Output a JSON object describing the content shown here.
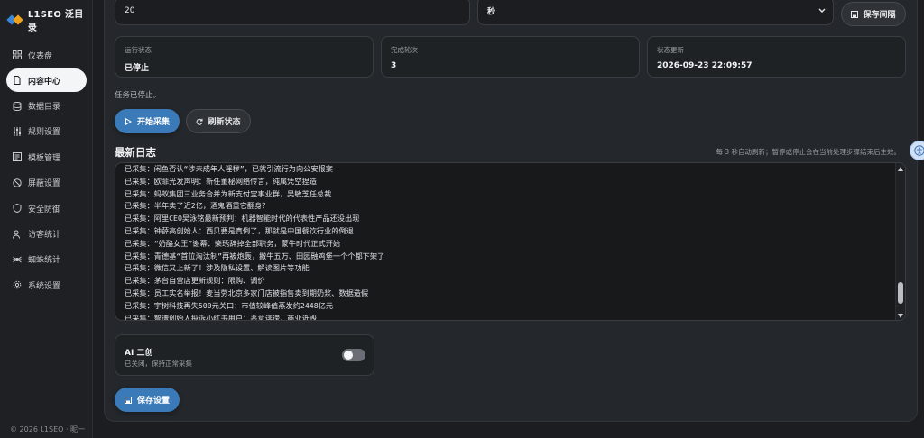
{
  "brand": {
    "name": "L1SEO 泛目录"
  },
  "nav": [
    {
      "label": "仪表盘",
      "icon": "grid-icon"
    },
    {
      "label": "内容中心",
      "icon": "file-icon",
      "active": true
    },
    {
      "label": "数据目录",
      "icon": "database-icon"
    },
    {
      "label": "规则设置",
      "icon": "sliders-icon"
    },
    {
      "label": "模板管理",
      "icon": "template-icon"
    },
    {
      "label": "屏蔽设置",
      "icon": "block-icon"
    },
    {
      "label": "安全防御",
      "icon": "shield-icon"
    },
    {
      "label": "访客统计",
      "icon": "users-icon"
    },
    {
      "label": "蜘蛛统计",
      "icon": "spider-icon"
    },
    {
      "label": "系统设置",
      "icon": "gear-icon"
    }
  ],
  "footer": "© 2026 L1SEO · 昵一",
  "interval": {
    "value": "20",
    "unit": "秒",
    "save_label": "保存间隔"
  },
  "stats": [
    {
      "label": "运行状态",
      "value": "已停止"
    },
    {
      "label": "完成轮次",
      "value": "3"
    },
    {
      "label": "状态更新",
      "value": "2026-09-23 22:09:57"
    }
  ],
  "status_message": "任务已停止。",
  "actions": {
    "start_label": "开始采集",
    "refresh_label": "刷新状态"
  },
  "log": {
    "title": "最新日志",
    "hint": "每 3 秒自动刷新；暂停或停止会在当前处理步骤结束后生效。",
    "lines": [
      "已采集：闲鱼否认“涉未成年人淫秽”，已就引流行为向公安报案",
      "已采集：欧菲光发声明：新任董秘网络传言，纯属凭空捏造",
      "已采集：蚂蚁集团三业务合并为新支付宝事业群，吴敏芝任总裁",
      "已采集：半年卖了近2亿，酒鬼酒重它翻身？",
      "已采集：阿里CEO吴泳铭最新预判：机器智能时代的代表性产品还没出现",
      "已采集：钟薛高创始人：西贝要是真倒了，那就是中国餐饮行业的倒退",
      "已采集：“奶酪女王”谢幕：柴琇辞掉全部职务，蒙牛时代正式开始",
      "已采集：青德基“首位淘汰制”再被炮轰，撇牛五万、田园融鸡堡一个个都下架了",
      "已采集：微信又上新了！涉及隐私设置、解读图片等功能",
      "已采集：茅台自营店更新规则：限购、调价",
      "已采集：员工实名举报！麦当劳北京多家门店被指售卖到期奶浆、数据造假",
      "已采集：宇树科技再失500元关口：市值较峰值蒸发约2448亿元",
      "已采集：智谱创始人投诉小红书用户：恶意诽谤，商业诋毁"
    ]
  },
  "ai": {
    "title": "AI 二创",
    "subtitle": "已关闭，保持正常采集",
    "enabled": false
  },
  "settings": {
    "save_label": "保存设置"
  },
  "colors": {
    "accent": "#3b7ab8",
    "background": "#1b1d20",
    "card": "#24272b"
  }
}
